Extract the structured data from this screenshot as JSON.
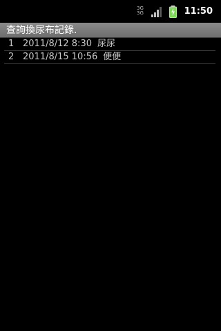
{
  "status_bar": {
    "network_label_top": "3G",
    "network_label_bottom": "3G",
    "signal_icon": "signal-bars-icon",
    "battery_icon": "battery-charging-icon",
    "time": "11:50"
  },
  "title_bar": {
    "title": "查詢換尿布記錄."
  },
  "records": [
    {
      "no": "1",
      "datetime": "2011/8/12 8:30",
      "type": "尿尿"
    },
    {
      "no": "2",
      "datetime": "2011/8/15 10:56",
      "type": "便便"
    }
  ],
  "colors": {
    "background": "#000000",
    "title_bar": "#7c7c7c",
    "row_text": "#c8c8c8",
    "battery": "#7ed957"
  }
}
